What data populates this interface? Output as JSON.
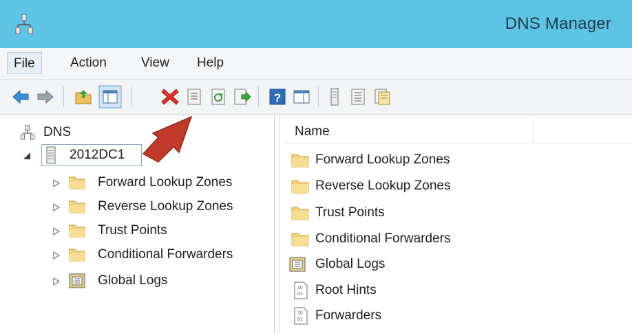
{
  "window": {
    "title": "DNS Manager"
  },
  "menu": {
    "file": "File",
    "action": "Action",
    "view": "View",
    "help": "Help"
  },
  "toolbar": {
    "buttons": [
      "back-icon",
      "forward-icon",
      "up-folder-icon",
      "show-hide-console-tree-icon",
      "delete-icon",
      "properties-icon",
      "refresh-icon",
      "export-list-icon",
      "help-icon",
      "show-action-pane-icon",
      "server-icon",
      "list-icon",
      "properties-sheet-icon"
    ]
  },
  "tree": {
    "root": "DNS",
    "server": "2012DC1",
    "children": [
      {
        "label": "Forward Lookup Zones",
        "icon": "folder-icon"
      },
      {
        "label": "Reverse Lookup Zones",
        "icon": "folder-icon"
      },
      {
        "label": "Trust Points",
        "icon": "folder-icon"
      },
      {
        "label": "Conditional Forwarders",
        "icon": "folder-icon"
      },
      {
        "label": "Global Logs",
        "icon": "log-icon"
      }
    ]
  },
  "list": {
    "column_name": "Name",
    "items": [
      {
        "label": "Forward Lookup Zones",
        "icon": "folder-icon"
      },
      {
        "label": "Reverse Lookup Zones",
        "icon": "folder-icon"
      },
      {
        "label": "Trust Points",
        "icon": "folder-icon"
      },
      {
        "label": "Conditional Forwarders",
        "icon": "folder-icon"
      },
      {
        "label": "Global Logs",
        "icon": "log-icon"
      },
      {
        "label": "Root Hints",
        "icon": "records-icon"
      },
      {
        "label": "Forwarders",
        "icon": "records-icon"
      }
    ]
  },
  "colors": {
    "titlebar": "#5ec4e6",
    "annotation_arrow": "#c0392b",
    "folder": "#f2d27a"
  }
}
